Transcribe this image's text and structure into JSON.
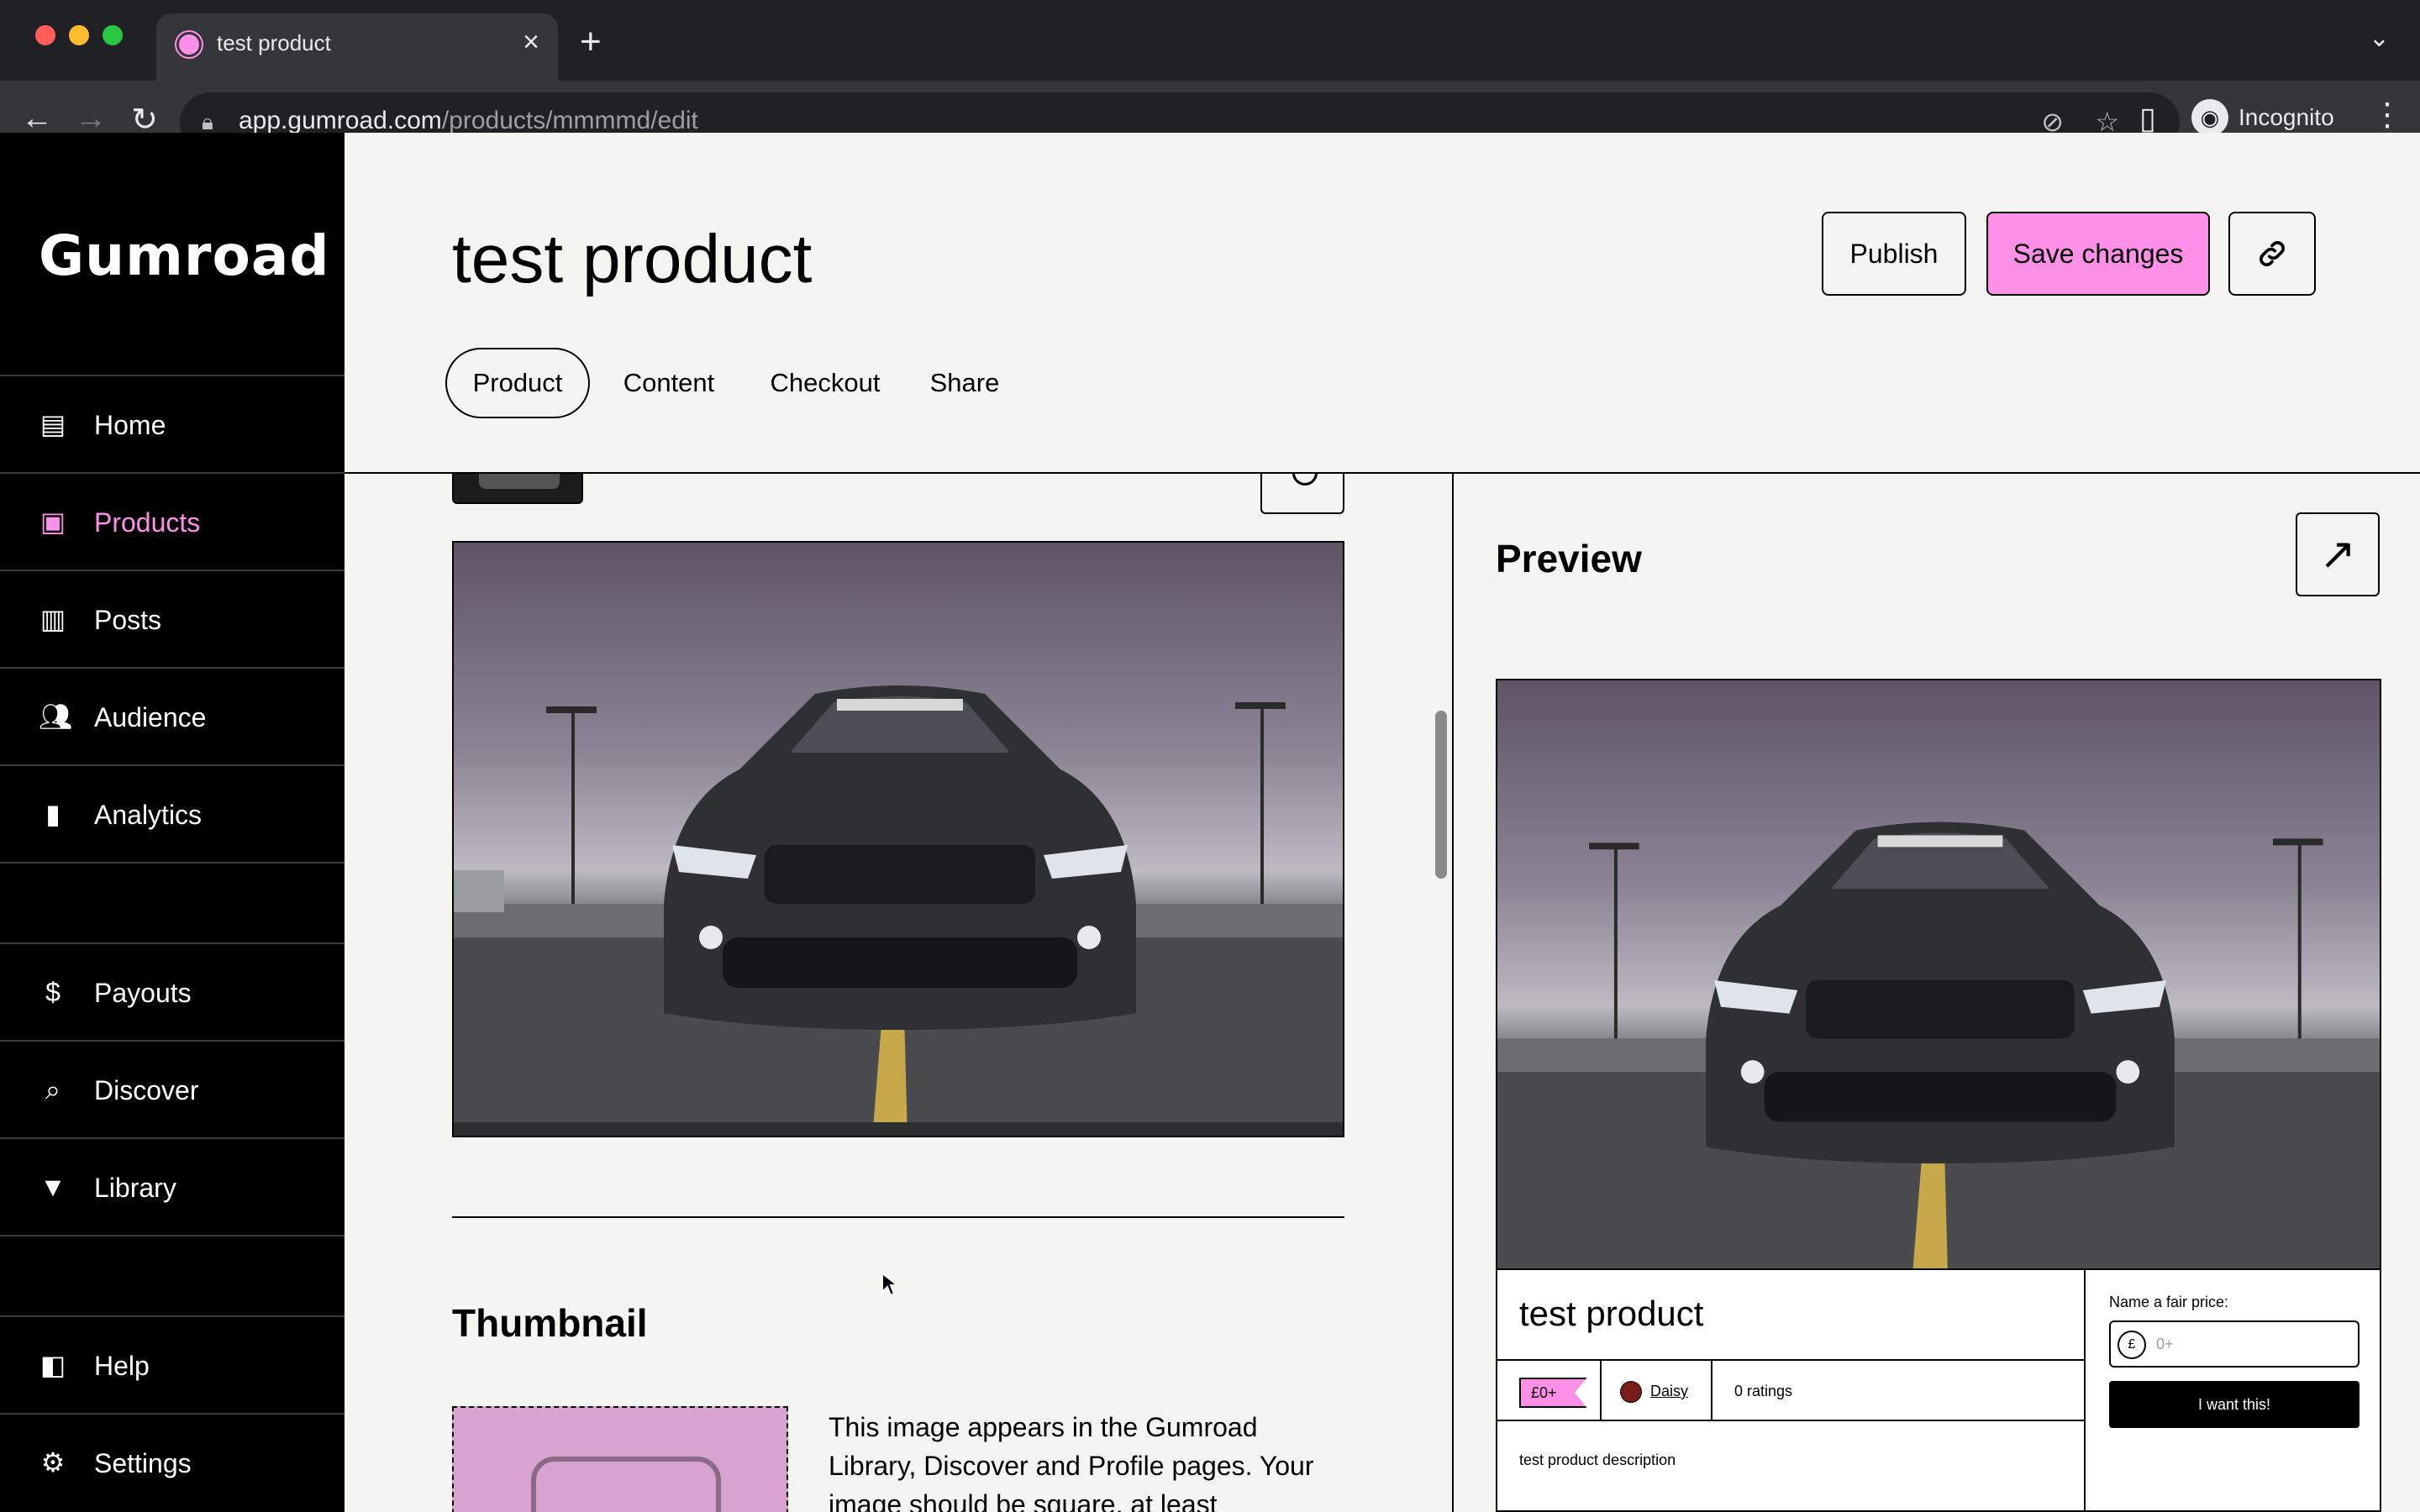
{
  "browser": {
    "tab_title": "test product",
    "url_host": "app.gumroad.com",
    "url_path": "/products/mmmmd/edit",
    "profile_label": "Incognito",
    "icons": [
      "back-icon",
      "forward-icon",
      "reload-icon",
      "lock-icon",
      "eye-slash-icon",
      "star-icon",
      "side-panel-icon",
      "incognito-icon",
      "kebab-menu-icon"
    ]
  },
  "sidebar": {
    "logo": "Gumroad",
    "items": [
      {
        "label": "Home",
        "icon": "store-icon"
      },
      {
        "label": "Products",
        "icon": "archive-icon",
        "active": true
      },
      {
        "label": "Posts",
        "icon": "document-icon"
      },
      {
        "label": "Audience",
        "icon": "people-icon"
      },
      {
        "label": "Analytics",
        "icon": "bar-chart-icon"
      },
      {
        "label": "Payouts",
        "icon": "dollar-icon"
      },
      {
        "label": "Discover",
        "icon": "search-icon"
      },
      {
        "label": "Library",
        "icon": "bookmark-icon"
      },
      {
        "label": "Help",
        "icon": "book-icon"
      },
      {
        "label": "Settings",
        "icon": "gear-icon"
      }
    ]
  },
  "header": {
    "title": "test product",
    "publish_label": "Publish",
    "save_label": "Save changes",
    "tabs": [
      "Product",
      "Content",
      "Checkout",
      "Share"
    ],
    "active_tab": "Product"
  },
  "editor": {
    "thumbnail_heading": "Thumbnail",
    "thumbnail_help": "This image appears in the Gumroad Library, Discover and Profile pages. Your image should be square, at least"
  },
  "preview": {
    "heading": "Preview",
    "product_name": "test product",
    "price": "£0+",
    "author": "Daisy",
    "ratings": "0 ratings",
    "description": "test product description",
    "fair_price_label": "Name a fair price:",
    "currency": "£",
    "price_placeholder": "0+",
    "buy_label": "I want this!"
  },
  "colors": {
    "brand_pink": "#ff90e8",
    "background": "#f4f4f0",
    "sidebar": "#000000"
  }
}
